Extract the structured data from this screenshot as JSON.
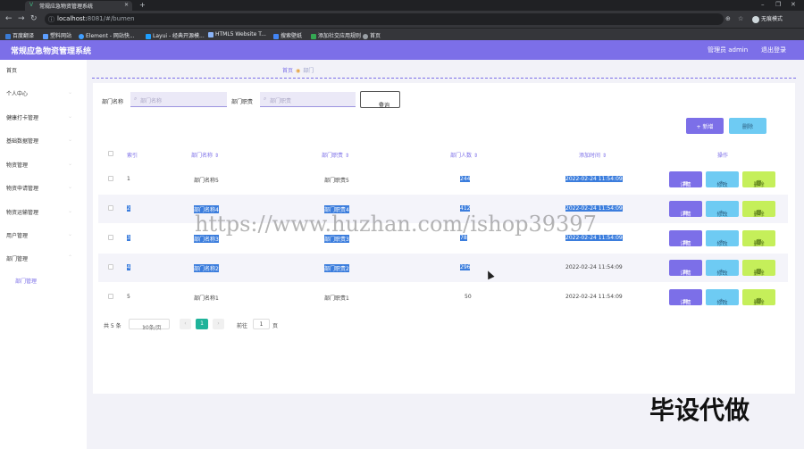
{
  "browser": {
    "tab_title": "常规应急物资管理系统",
    "url_host": "localhost:",
    "url_rest": "8081/#/bumen",
    "profile_label": "无痕模式",
    "bookmarks": [
      "百度翻译",
      "塑料网站",
      "Element - 网站快...",
      "Layui - 经典开源模...",
      "HTML5 Website T...",
      "搜索壁纸",
      "添加社交应用规则",
      "首页"
    ]
  },
  "header": {
    "title": "常规应急物资管理系统",
    "user": "管理员 admin",
    "logout": "退出登录"
  },
  "sidebar": {
    "items": [
      {
        "label": "首页"
      },
      {
        "label": "个人中心"
      },
      {
        "label": "健康打卡管理"
      },
      {
        "label": "基础数据管理"
      },
      {
        "label": "物资管理"
      },
      {
        "label": "物资申请管理"
      },
      {
        "label": "物资运输管理"
      },
      {
        "label": "用户管理"
      },
      {
        "label": "部门管理"
      }
    ],
    "sub_item": "部门管理"
  },
  "breadcrumb": {
    "home": "首页",
    "current": "部门"
  },
  "search": {
    "name_label": "部门名称",
    "name_placeholder": "部门名称",
    "duty_label": "部门职责",
    "duty_placeholder": "部门职责",
    "query_button": "查询"
  },
  "toolbar": {
    "add": "+ 新增",
    "delete": "删除"
  },
  "table": {
    "headers": [
      "索引",
      "部门名称",
      "部门职责",
      "部门人数",
      "添加时间",
      "操作"
    ],
    "rows": [
      {
        "index": "1",
        "name": "部门名称5",
        "duty": "部门职责5",
        "count": "244",
        "time": "2022-02-24 11:54:09",
        "selected": false
      },
      {
        "index": "2",
        "name": "部门名称4",
        "duty": "部门职责4",
        "count": "412",
        "time": "2022-02-24 11:54:09",
        "selected": true
      },
      {
        "index": "3",
        "name": "部门名称3",
        "duty": "部门职责3",
        "count": "78",
        "time": "2022-02-24 11:54:09",
        "selected": true
      },
      {
        "index": "4",
        "name": "部门名称2",
        "duty": "部门职责2",
        "count": "296",
        "time": "2022-02-24 11:54:09",
        "selected": true
      },
      {
        "index": "5",
        "name": "部门名称1",
        "duty": "部门职责1",
        "count": "50",
        "time": "2022-02-24 11:54:09",
        "selected": false
      }
    ],
    "row_actions": {
      "detail": "详情",
      "edit": "修改",
      "delete": "删除"
    }
  },
  "pagination": {
    "total": "共 5 条",
    "page_size": "10条/页",
    "current_page": "1",
    "goto_label": "前往",
    "goto_value": "1",
    "page_suffix": "页"
  },
  "watermark": "https://www.huzhan.com/ishop39397",
  "corner_mark": "毕设代做",
  "colors": {
    "primary": "#7c6fe8",
    "info": "#6ecbf3",
    "lime": "#c5ef5a",
    "selection": "#3b7ddd",
    "pager_active": "#1fb39a"
  }
}
